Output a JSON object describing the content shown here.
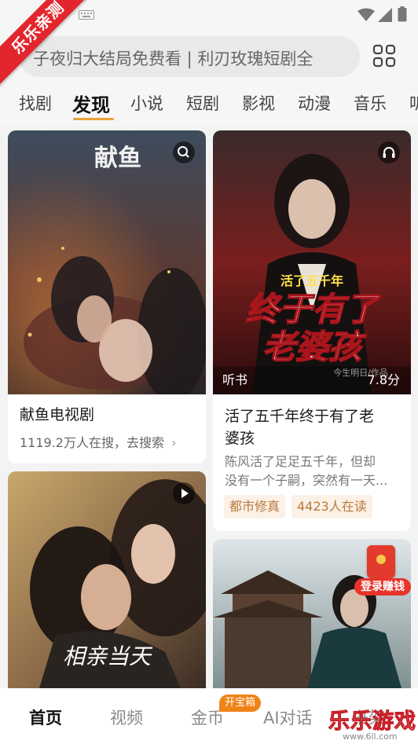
{
  "corner_badge": "乐乐亲测",
  "search": {
    "placeholder": "子夜归大结局免费看 | 利刃玫瑰短剧全"
  },
  "tabs": [
    "找剧",
    "发现",
    "小说",
    "短剧",
    "影视",
    "动漫",
    "音乐",
    "听"
  ],
  "feed": {
    "card1": {
      "poster_title": "献鱼",
      "title": "献鱼电视剧",
      "subtitle": "1119.2万人在搜，去搜索",
      "chevron": "›"
    },
    "card2": {
      "poster_small": "活了五千年",
      "poster_big_1": "终于有了",
      "poster_big_2": "老婆孩",
      "poster_author": "今生明日/作品",
      "label": "听书",
      "score": "7.8分",
      "title_line1": "活了五千年终于有了老",
      "title_line2": "婆孩",
      "desc_line1": "陈风活了足足五千年，但却",
      "desc_line2": "没有一个子嗣，突然有一天...",
      "tags": [
        "都市修真",
        "4423人在读"
      ]
    },
    "card3": {
      "poster_title": "相亲当天"
    },
    "card4": {
      "button": "登录赚钱"
    }
  },
  "bottom_nav": [
    "首页",
    "视频",
    "金币",
    "AI对话",
    "书架"
  ],
  "coin_badge": "开宝箱",
  "watermark": {
    "main": "乐乐游戏",
    "sub": "www.6ll.com"
  },
  "colors": {
    "accent": "#e8a23a",
    "ribbon": "#e3262d",
    "tag_bg": "#fbf1e6",
    "tag_text": "#b97a3c",
    "coin_badge": "#f08318"
  },
  "icons": [
    "wifi-icon",
    "signal-icon",
    "battery-icon",
    "grid-icon",
    "search-icon",
    "headphone-icon",
    "play-icon",
    "chevron-right-icon"
  ]
}
